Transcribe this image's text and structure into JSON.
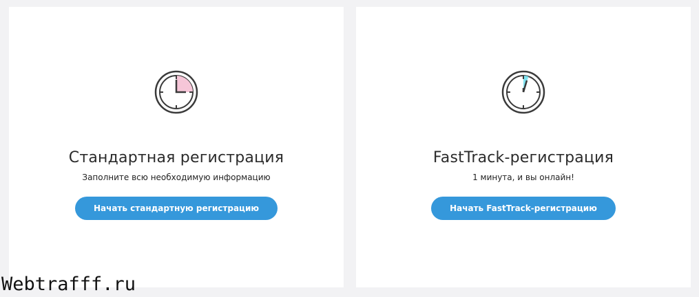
{
  "standard": {
    "icon": "clock-quarter-icon",
    "title": "Стандартная регистрация",
    "subtitle": "Заполните всю необходимую информацию",
    "button_label": "Начать стандартную регистрацию",
    "accent_color": "#f6c6d8"
  },
  "fasttrack": {
    "icon": "clock-fast-icon",
    "title": "FastTrack-регистрация",
    "subtitle": "1 минута, и вы онлайн!",
    "button_label": "Начать FastTrack-регистрацию",
    "accent_color": "#7fe3f0"
  },
  "colors": {
    "button": "#3598db",
    "background": "#f2f2f4",
    "card": "#ffffff"
  },
  "watermark": "Webtrafff.ru"
}
